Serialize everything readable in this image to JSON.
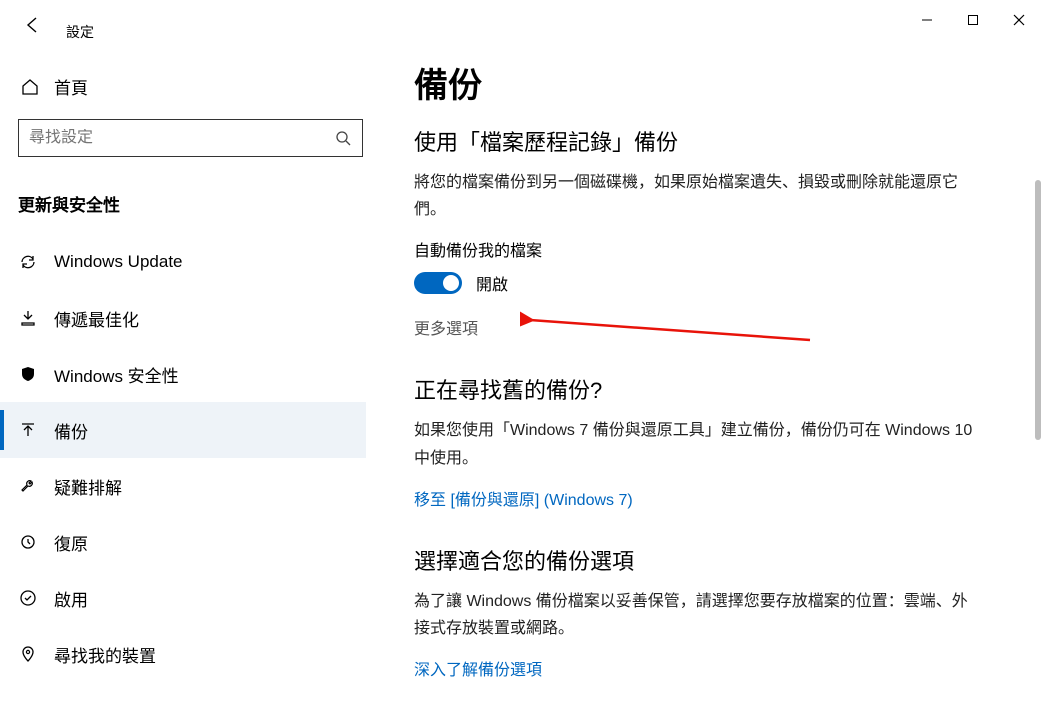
{
  "window": {
    "app_title": "設定"
  },
  "sidebar": {
    "home_label": "首頁",
    "search_placeholder": "尋找設定",
    "section_header": "更新與安全性",
    "items": [
      {
        "label": "Windows Update"
      },
      {
        "label": "傳遞最佳化"
      },
      {
        "label": "Windows 安全性"
      },
      {
        "label": "備份"
      },
      {
        "label": "疑難排解"
      },
      {
        "label": "復原"
      },
      {
        "label": "啟用"
      },
      {
        "label": "尋找我的裝置"
      }
    ]
  },
  "main": {
    "page_title": "備份",
    "section1": {
      "heading": "使用「檔案歷程記錄」備份",
      "desc": "將您的檔案備份到另一個磁碟機，如果原始檔案遺失、損毀或刪除就能還原它們。",
      "toggle_label": "自動備份我的檔案",
      "toggle_state": "開啟",
      "more_options": "更多選項"
    },
    "section2": {
      "heading": "正在尋找舊的備份?",
      "desc": "如果您使用「Windows 7 備份與還原工具」建立備份，備份仍可在 Windows 10 中使用。",
      "link": "移至 [備份與還原] (Windows 7)"
    },
    "section3": {
      "heading": "選擇適合您的備份選項",
      "desc": "為了讓 Windows 備份檔案以妥善保管，請選擇您要存放檔案的位置：雲端、外接式存放裝置或網路。",
      "link": "深入了解備份選項"
    }
  }
}
